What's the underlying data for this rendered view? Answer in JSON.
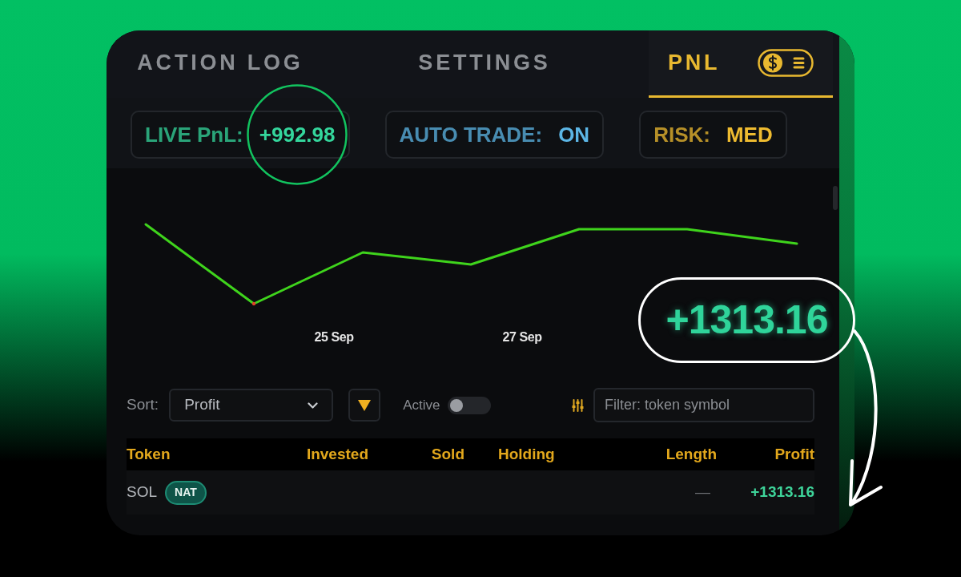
{
  "tabs": [
    {
      "label": "ACTION LOG",
      "selected": false
    },
    {
      "label": "SETTINGS",
      "selected": false
    },
    {
      "label": "PNL",
      "selected": true
    }
  ],
  "stats": [
    {
      "label": "LIVE PnL:",
      "value": "+992.98",
      "color": "#34d69c"
    },
    {
      "label": "AUTO TRADE:",
      "value": "ON",
      "color": "#5cb6e6"
    },
    {
      "label": "RISK:",
      "value": "MED",
      "color": "#eebb30"
    }
  ],
  "chart": {
    "x_labels": [
      "25 Sep",
      "27 Sep"
    ],
    "callout": "+1313.16"
  },
  "controls": {
    "sort": {
      "label": "Sort:",
      "value": "Profit"
    },
    "active": {
      "label": "Active",
      "on": false
    },
    "filter": {
      "placeholder": "Filter: token symbol"
    }
  },
  "table": {
    "columns": [
      "Token",
      "Invested",
      "Sold",
      "Holding",
      "Length",
      "Profit"
    ],
    "rows": [
      {
        "token": "SOL",
        "badge": "NAT",
        "length": "—",
        "profit": "+1313.16"
      }
    ]
  }
}
